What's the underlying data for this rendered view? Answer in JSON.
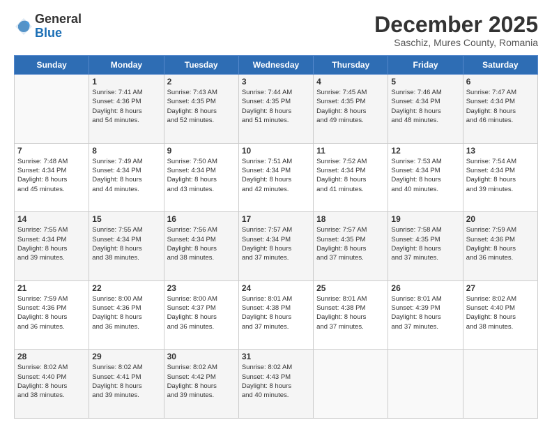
{
  "logo": {
    "general": "General",
    "blue": "Blue"
  },
  "header": {
    "month": "December 2025",
    "location": "Saschiz, Mures County, Romania"
  },
  "days_of_week": [
    "Sunday",
    "Monday",
    "Tuesday",
    "Wednesday",
    "Thursday",
    "Friday",
    "Saturday"
  ],
  "weeks": [
    [
      {
        "day": "",
        "info": ""
      },
      {
        "day": "1",
        "info": "Sunrise: 7:41 AM\nSunset: 4:36 PM\nDaylight: 8 hours\nand 54 minutes."
      },
      {
        "day": "2",
        "info": "Sunrise: 7:43 AM\nSunset: 4:35 PM\nDaylight: 8 hours\nand 52 minutes."
      },
      {
        "day": "3",
        "info": "Sunrise: 7:44 AM\nSunset: 4:35 PM\nDaylight: 8 hours\nand 51 minutes."
      },
      {
        "day": "4",
        "info": "Sunrise: 7:45 AM\nSunset: 4:35 PM\nDaylight: 8 hours\nand 49 minutes."
      },
      {
        "day": "5",
        "info": "Sunrise: 7:46 AM\nSunset: 4:34 PM\nDaylight: 8 hours\nand 48 minutes."
      },
      {
        "day": "6",
        "info": "Sunrise: 7:47 AM\nSunset: 4:34 PM\nDaylight: 8 hours\nand 46 minutes."
      }
    ],
    [
      {
        "day": "7",
        "info": "Sunrise: 7:48 AM\nSunset: 4:34 PM\nDaylight: 8 hours\nand 45 minutes."
      },
      {
        "day": "8",
        "info": "Sunrise: 7:49 AM\nSunset: 4:34 PM\nDaylight: 8 hours\nand 44 minutes."
      },
      {
        "day": "9",
        "info": "Sunrise: 7:50 AM\nSunset: 4:34 PM\nDaylight: 8 hours\nand 43 minutes."
      },
      {
        "day": "10",
        "info": "Sunrise: 7:51 AM\nSunset: 4:34 PM\nDaylight: 8 hours\nand 42 minutes."
      },
      {
        "day": "11",
        "info": "Sunrise: 7:52 AM\nSunset: 4:34 PM\nDaylight: 8 hours\nand 41 minutes."
      },
      {
        "day": "12",
        "info": "Sunrise: 7:53 AM\nSunset: 4:34 PM\nDaylight: 8 hours\nand 40 minutes."
      },
      {
        "day": "13",
        "info": "Sunrise: 7:54 AM\nSunset: 4:34 PM\nDaylight: 8 hours\nand 39 minutes."
      }
    ],
    [
      {
        "day": "14",
        "info": "Sunrise: 7:55 AM\nSunset: 4:34 PM\nDaylight: 8 hours\nand 39 minutes."
      },
      {
        "day": "15",
        "info": "Sunrise: 7:55 AM\nSunset: 4:34 PM\nDaylight: 8 hours\nand 38 minutes."
      },
      {
        "day": "16",
        "info": "Sunrise: 7:56 AM\nSunset: 4:34 PM\nDaylight: 8 hours\nand 38 minutes."
      },
      {
        "day": "17",
        "info": "Sunrise: 7:57 AM\nSunset: 4:34 PM\nDaylight: 8 hours\nand 37 minutes."
      },
      {
        "day": "18",
        "info": "Sunrise: 7:57 AM\nSunset: 4:35 PM\nDaylight: 8 hours\nand 37 minutes."
      },
      {
        "day": "19",
        "info": "Sunrise: 7:58 AM\nSunset: 4:35 PM\nDaylight: 8 hours\nand 37 minutes."
      },
      {
        "day": "20",
        "info": "Sunrise: 7:59 AM\nSunset: 4:36 PM\nDaylight: 8 hours\nand 36 minutes."
      }
    ],
    [
      {
        "day": "21",
        "info": "Sunrise: 7:59 AM\nSunset: 4:36 PM\nDaylight: 8 hours\nand 36 minutes."
      },
      {
        "day": "22",
        "info": "Sunrise: 8:00 AM\nSunset: 4:36 PM\nDaylight: 8 hours\nand 36 minutes."
      },
      {
        "day": "23",
        "info": "Sunrise: 8:00 AM\nSunset: 4:37 PM\nDaylight: 8 hours\nand 36 minutes."
      },
      {
        "day": "24",
        "info": "Sunrise: 8:01 AM\nSunset: 4:38 PM\nDaylight: 8 hours\nand 37 minutes."
      },
      {
        "day": "25",
        "info": "Sunrise: 8:01 AM\nSunset: 4:38 PM\nDaylight: 8 hours\nand 37 minutes."
      },
      {
        "day": "26",
        "info": "Sunrise: 8:01 AM\nSunset: 4:39 PM\nDaylight: 8 hours\nand 37 minutes."
      },
      {
        "day": "27",
        "info": "Sunrise: 8:02 AM\nSunset: 4:40 PM\nDaylight: 8 hours\nand 38 minutes."
      }
    ],
    [
      {
        "day": "28",
        "info": "Sunrise: 8:02 AM\nSunset: 4:40 PM\nDaylight: 8 hours\nand 38 minutes."
      },
      {
        "day": "29",
        "info": "Sunrise: 8:02 AM\nSunset: 4:41 PM\nDaylight: 8 hours\nand 39 minutes."
      },
      {
        "day": "30",
        "info": "Sunrise: 8:02 AM\nSunset: 4:42 PM\nDaylight: 8 hours\nand 39 minutes."
      },
      {
        "day": "31",
        "info": "Sunrise: 8:02 AM\nSunset: 4:43 PM\nDaylight: 8 hours\nand 40 minutes."
      },
      {
        "day": "",
        "info": ""
      },
      {
        "day": "",
        "info": ""
      },
      {
        "day": "",
        "info": ""
      }
    ]
  ]
}
